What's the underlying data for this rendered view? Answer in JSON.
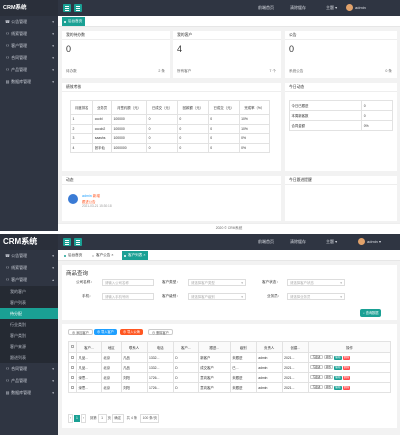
{
  "app": {
    "title": "CRM系统"
  },
  "sidebar": {
    "items": [
      {
        "icon": "☎",
        "label": "公告管理"
      },
      {
        "icon": "⚇",
        "label": "线索管理"
      },
      {
        "icon": "⚇",
        "label": "客户管理"
      },
      {
        "icon": "⚇",
        "label": "合同管理"
      },
      {
        "icon": "⚇",
        "label": "产品管理"
      },
      {
        "icon": "▤",
        "label": "数据库管理"
      }
    ],
    "customer_sub": [
      "我的客户",
      "客户列表",
      "待分配",
      "行业类别",
      "客户类别",
      "客户来源",
      "跟进列表"
    ]
  },
  "topbar": {
    "home": "前端首页",
    "clear_cache": "清除缓存",
    "theme": "主题",
    "user": "admin"
  },
  "tabs": {
    "home": "后台首页",
    "customer_notice": "客户公告",
    "customer_list": "客户列表"
  },
  "dashboard": {
    "cards": [
      {
        "title": "我的待办数",
        "value": "0",
        "sub": "待办数",
        "count": "2 条"
      },
      {
        "title": "我的客户",
        "value": "4",
        "sub": "所有客户",
        "count": "7 个"
      },
      {
        "title": "公告",
        "value": "0",
        "sub": "系统公告",
        "count": "0 条"
      }
    ],
    "perf": {
      "title": "绩效考核",
      "headers": [
        "月度排名",
        "业务员",
        "月签约额（元）",
        "已成交（元）",
        "回款额（元）",
        "已成交（元）",
        "完成率（%）"
      ],
      "rows": [
        [
          "1",
          "cccbl",
          "100000",
          "0",
          "0",
          "0",
          "10%"
        ],
        [
          "2",
          "ccccb2",
          "100000",
          "0",
          "0",
          "0",
          "10%"
        ],
        [
          "3",
          "saashs",
          "100000",
          "0",
          "0",
          "0",
          "0%"
        ],
        [
          "4",
          "张半仙",
          "1000000",
          "0",
          "0",
          "0",
          "0%"
        ]
      ]
    },
    "today": {
      "title": "今日动态",
      "rows": [
        [
          "今日已跟进",
          "0"
        ],
        [
          "本周新客数",
          "0"
        ],
        [
          "合同金额",
          "0%"
        ]
      ]
    },
    "activity": {
      "title": "动态",
      "user": "admin",
      "tag": "新增",
      "text": "跟进公告",
      "time": "2021-03-21 15:30:18"
    },
    "reminder": {
      "title": "今日跟进提醒"
    },
    "footer": "2020 © CRM系统"
  },
  "customers": {
    "search_title": "商品查询",
    "form": {
      "name_label": "公司名称：",
      "name_ph": "请输入公司名称",
      "phone_label": "手机：",
      "phone_ph": "请输入手机号码",
      "type_label": "客户类型：",
      "type_ph": "请选择客户类型",
      "level_label": "客户级别：",
      "level_ph": "请选择客户级别",
      "status_label": "客户状态：",
      "status_ph": "请选择客户状态",
      "owner_label": "业务员：",
      "owner_ph": "请选择业务员",
      "search_btn": "查询数据"
    },
    "toolbar": {
      "add": "添加客户",
      "import": "导入客户",
      "export": "导入公海",
      "delete": "删除客户"
    },
    "headers": [
      "",
      "客户...",
      "地区",
      "联系人",
      "电话",
      "客户...",
      "跟进...",
      "级别",
      "负责人",
      "创建...",
      "操作"
    ],
    "rows": [
      [
        "",
        "凡品...",
        "北京",
        "凡品",
        "1332...",
        "D",
        "新客户",
        "未跟进",
        "dsd",
        "admin",
        "2021..."
      ],
      [
        "",
        "凡品...",
        "北京",
        "凡品",
        "1332...",
        "D",
        "成交客户",
        "已...",
        "cccbl",
        "admin",
        "2021..."
      ],
      [
        "",
        "深思...",
        "北京",
        "刘阳",
        "1726...",
        "D",
        "意向客户",
        "未跟进",
        "cccbl",
        "admin",
        "2021..."
      ],
      [
        "",
        "深思...",
        "北京",
        "刘阳",
        "1726...",
        "D",
        "意向客户",
        "未跟进",
        "",
        "admin",
        "2021..."
      ]
    ],
    "row_actions": [
      "写跟进",
      "转移",
      "编辑",
      "删除"
    ],
    "pager": {
      "page": "1",
      "goto": "到第",
      "page_unit": "页",
      "confirm": "确定",
      "total": "共 4 条",
      "per_page": "100 条/页"
    }
  },
  "colors": {
    "sidebar": "#2f3542",
    "accent": "#1aa094",
    "blue": "#1e9fff",
    "orange": "#ff5722",
    "red": "#ff4d4f"
  }
}
